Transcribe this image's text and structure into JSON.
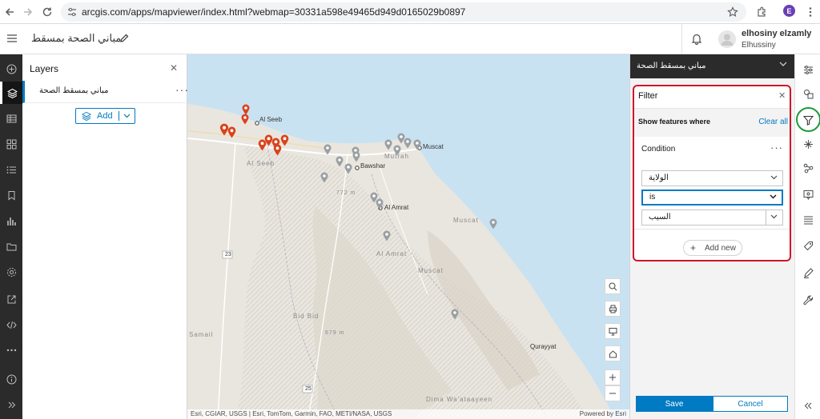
{
  "browser": {
    "url": "arcgis.com/apps/mapviewer/index.html?webmap=30331a598e49465d949d0165029b0897",
    "profile_initial": "E"
  },
  "header": {
    "map_title": "مباني الصحة بمسقط",
    "user_name": "elhosiny elzamly",
    "user_sub": "Elhussiny"
  },
  "layers_panel": {
    "title": "Layers",
    "layer_name": "مباني بمسقط الصحة",
    "add_label": "Add"
  },
  "map": {
    "labels": {
      "al_seeb": "Al Seeb",
      "al_seeb_region": "Al Seeb",
      "muscat": "Muscat",
      "mutrah": "Mutrah",
      "bawshar": "Bawshar",
      "al_amrat": "Al Amrat",
      "al_amrat_region": "Al Amrat",
      "muscat_region": "Muscat",
      "muscat_region2": "Muscat",
      "bid_bid": "Bid Bid",
      "samail": "Samail",
      "quriyat": "Qurayyat",
      "dima": "Dima Wa'ataayeen",
      "elev_772": "772 m",
      "elev_679": "679 m",
      "road_23": "23",
      "road_25": "25"
    },
    "attribution_left": "Esri, CGIAR, USGS | Esri, TomTom, Garmin, FAO, METI/NASA, USGS",
    "attribution_right": "Powered by Esri"
  },
  "right_panel": {
    "layer_title": "مباني بمسقط الصحة",
    "filter": {
      "title": "Filter",
      "show_where": "Show features where",
      "clear_all": "Clear all",
      "condition_title": "Condition",
      "field_value": "الولاية",
      "operator_value": "is",
      "value_value": "السيب",
      "add_new": "Add new"
    },
    "save_label": "Save",
    "cancel_label": "Cancel"
  },
  "colors": {
    "accent": "#007ac2",
    "highlight_red": "#d0152a",
    "highlight_green": "#1f9a3c",
    "pin_orange": "#d9431b",
    "pin_gray": "#9a9fa3"
  }
}
